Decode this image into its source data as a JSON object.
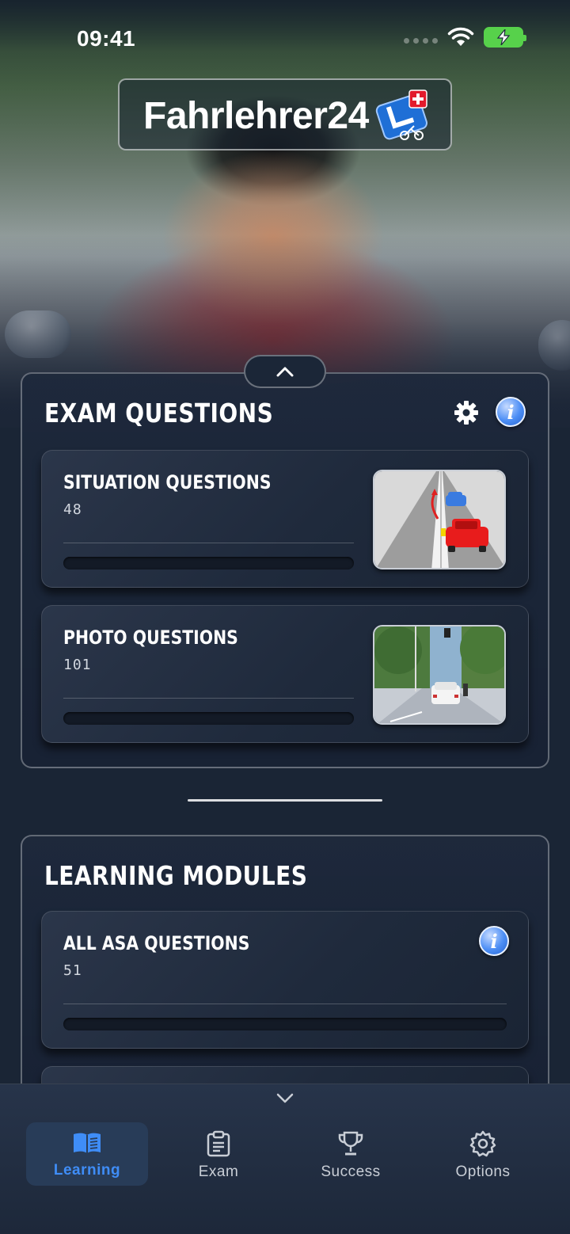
{
  "status_bar": {
    "time": "09:41"
  },
  "header": {
    "logo_text": "Fahrlehrer24"
  },
  "exam_section": {
    "title": "EXAM QUESTIONS",
    "cards": [
      {
        "title": "SITUATION QUESTIONS",
        "count": "48",
        "progress": 0
      },
      {
        "title": "PHOTO QUESTIONS",
        "count": "101",
        "progress": 0
      }
    ]
  },
  "learning_section": {
    "title": "LEARNING MODULES",
    "cards": [
      {
        "title": "ALL ASA QUESTIONS",
        "count": "51",
        "progress": 0
      }
    ]
  },
  "tabbar": {
    "tabs": [
      {
        "label": "Learning",
        "icon": "book-icon",
        "active": true
      },
      {
        "label": "Exam",
        "icon": "clipboard-icon",
        "active": false
      },
      {
        "label": "Success",
        "icon": "trophy-icon",
        "active": false
      },
      {
        "label": "Options",
        "icon": "gear-icon",
        "active": false
      }
    ]
  },
  "colors": {
    "accent": "#3f8df7",
    "background": "#1a2535",
    "battery": "#57d14b",
    "info_blue": "#4c8ef5"
  }
}
